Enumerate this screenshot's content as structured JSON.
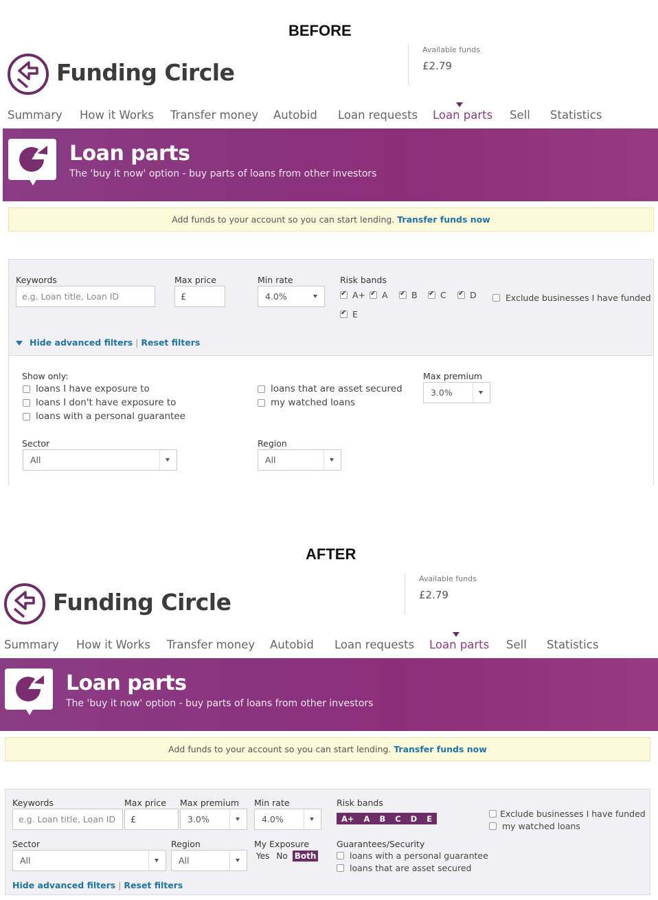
{
  "labels": {
    "before": "BEFORE",
    "after": "AFTER"
  },
  "logo": {
    "name": "Funding Circle"
  },
  "funds": {
    "label": "Available funds",
    "value": "£2.79"
  },
  "nav": [
    "Summary",
    "How it Works",
    "Transfer money",
    "Autobid",
    "Loan requests",
    "Loan parts",
    "Sell",
    "Statistics"
  ],
  "nav_active": "Loan parts",
  "banner": {
    "title": "Loan parts",
    "subtitle": "The 'buy it now' option - buy parts of loans from other investors"
  },
  "notice": {
    "text": "Add funds to your account so you can start lending.",
    "link": "Transfer funds now"
  },
  "before": {
    "keywords_label": "Keywords",
    "keywords_placeholder": "e.g. Loan title, Loan ID",
    "max_price_label": "Max price",
    "max_price_prefix": "£",
    "min_rate_label": "Min rate",
    "min_rate_value": "4.0%",
    "risk_label": "Risk bands",
    "risk_bands": [
      "A+",
      "A",
      "B",
      "C",
      "D",
      "E"
    ],
    "exclude_label": "Exclude businesses I have funded",
    "hide_filters": "Hide advanced filters",
    "reset_filters": "Reset filters",
    "show_only_label": "Show only:",
    "show_only_left": [
      "loans I have exposure to",
      "loans I don't have exposure to",
      "loans with a personal guarantee"
    ],
    "show_only_right": [
      "loans that are asset secured",
      "my watched loans"
    ],
    "max_premium_label": "Max premium",
    "max_premium_value": "3.0%",
    "sector_label": "Sector",
    "sector_value": "All",
    "region_label": "Region",
    "region_value": "All"
  },
  "after": {
    "keywords_label": "Keywords",
    "keywords_placeholder": "e.g. Loan title, Loan ID",
    "max_price_label": "Max price",
    "max_price_prefix": "£",
    "max_premium_label": "Max premium",
    "max_premium_value": "3.0%",
    "min_rate_label": "Min rate",
    "min_rate_value": "4.0%",
    "risk_label": "Risk bands",
    "risk_bands": [
      "A+",
      "A",
      "B",
      "C",
      "D",
      "E"
    ],
    "exclude_label": "Exclude businesses I have funded",
    "watched_label": "my watched loans",
    "sector_label": "Sector",
    "sector_value": "All",
    "region_label": "Region",
    "region_value": "All",
    "exposure_label": "My Exposure",
    "exposure_options": [
      "Yes",
      "No",
      "Both"
    ],
    "exposure_selected": "Both",
    "guarantee_label": "Guarantees/Security",
    "guarantee_options": [
      "loans with a personal guarantee",
      "loans that are asset secured"
    ],
    "hide_filters": "Hide advanced filters",
    "reset_filters": "Reset filters"
  }
}
